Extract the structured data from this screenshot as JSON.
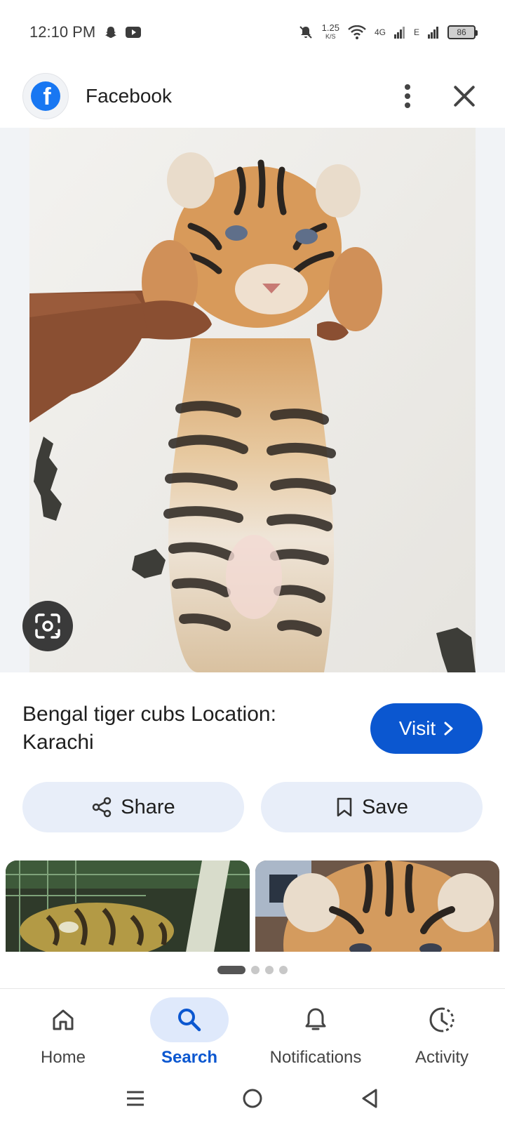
{
  "status_bar": {
    "time": "12:10 PM",
    "speed_value": "1.25",
    "speed_unit": "K/S",
    "network_4g": "4G",
    "network_e": "E",
    "battery": "86"
  },
  "header": {
    "source": "Facebook",
    "logo_letter": "f"
  },
  "result": {
    "caption": "Bengal tiger cubs Location: Karachi",
    "visit_label": "Visit"
  },
  "actions": {
    "share_label": "Share",
    "save_label": "Save"
  },
  "pager": {
    "count": 4,
    "active": 0
  },
  "bottom_nav": {
    "items": [
      {
        "label": "Home",
        "icon": "home-icon"
      },
      {
        "label": "Search",
        "icon": "search-icon"
      },
      {
        "label": "Notifications",
        "icon": "bell-icon"
      },
      {
        "label": "Activity",
        "icon": "activity-icon"
      }
    ],
    "active": "Search"
  },
  "colors": {
    "accent": "#0b57d0",
    "pill_bg": "#e8eef9",
    "facebook_blue": "#1877f2"
  }
}
